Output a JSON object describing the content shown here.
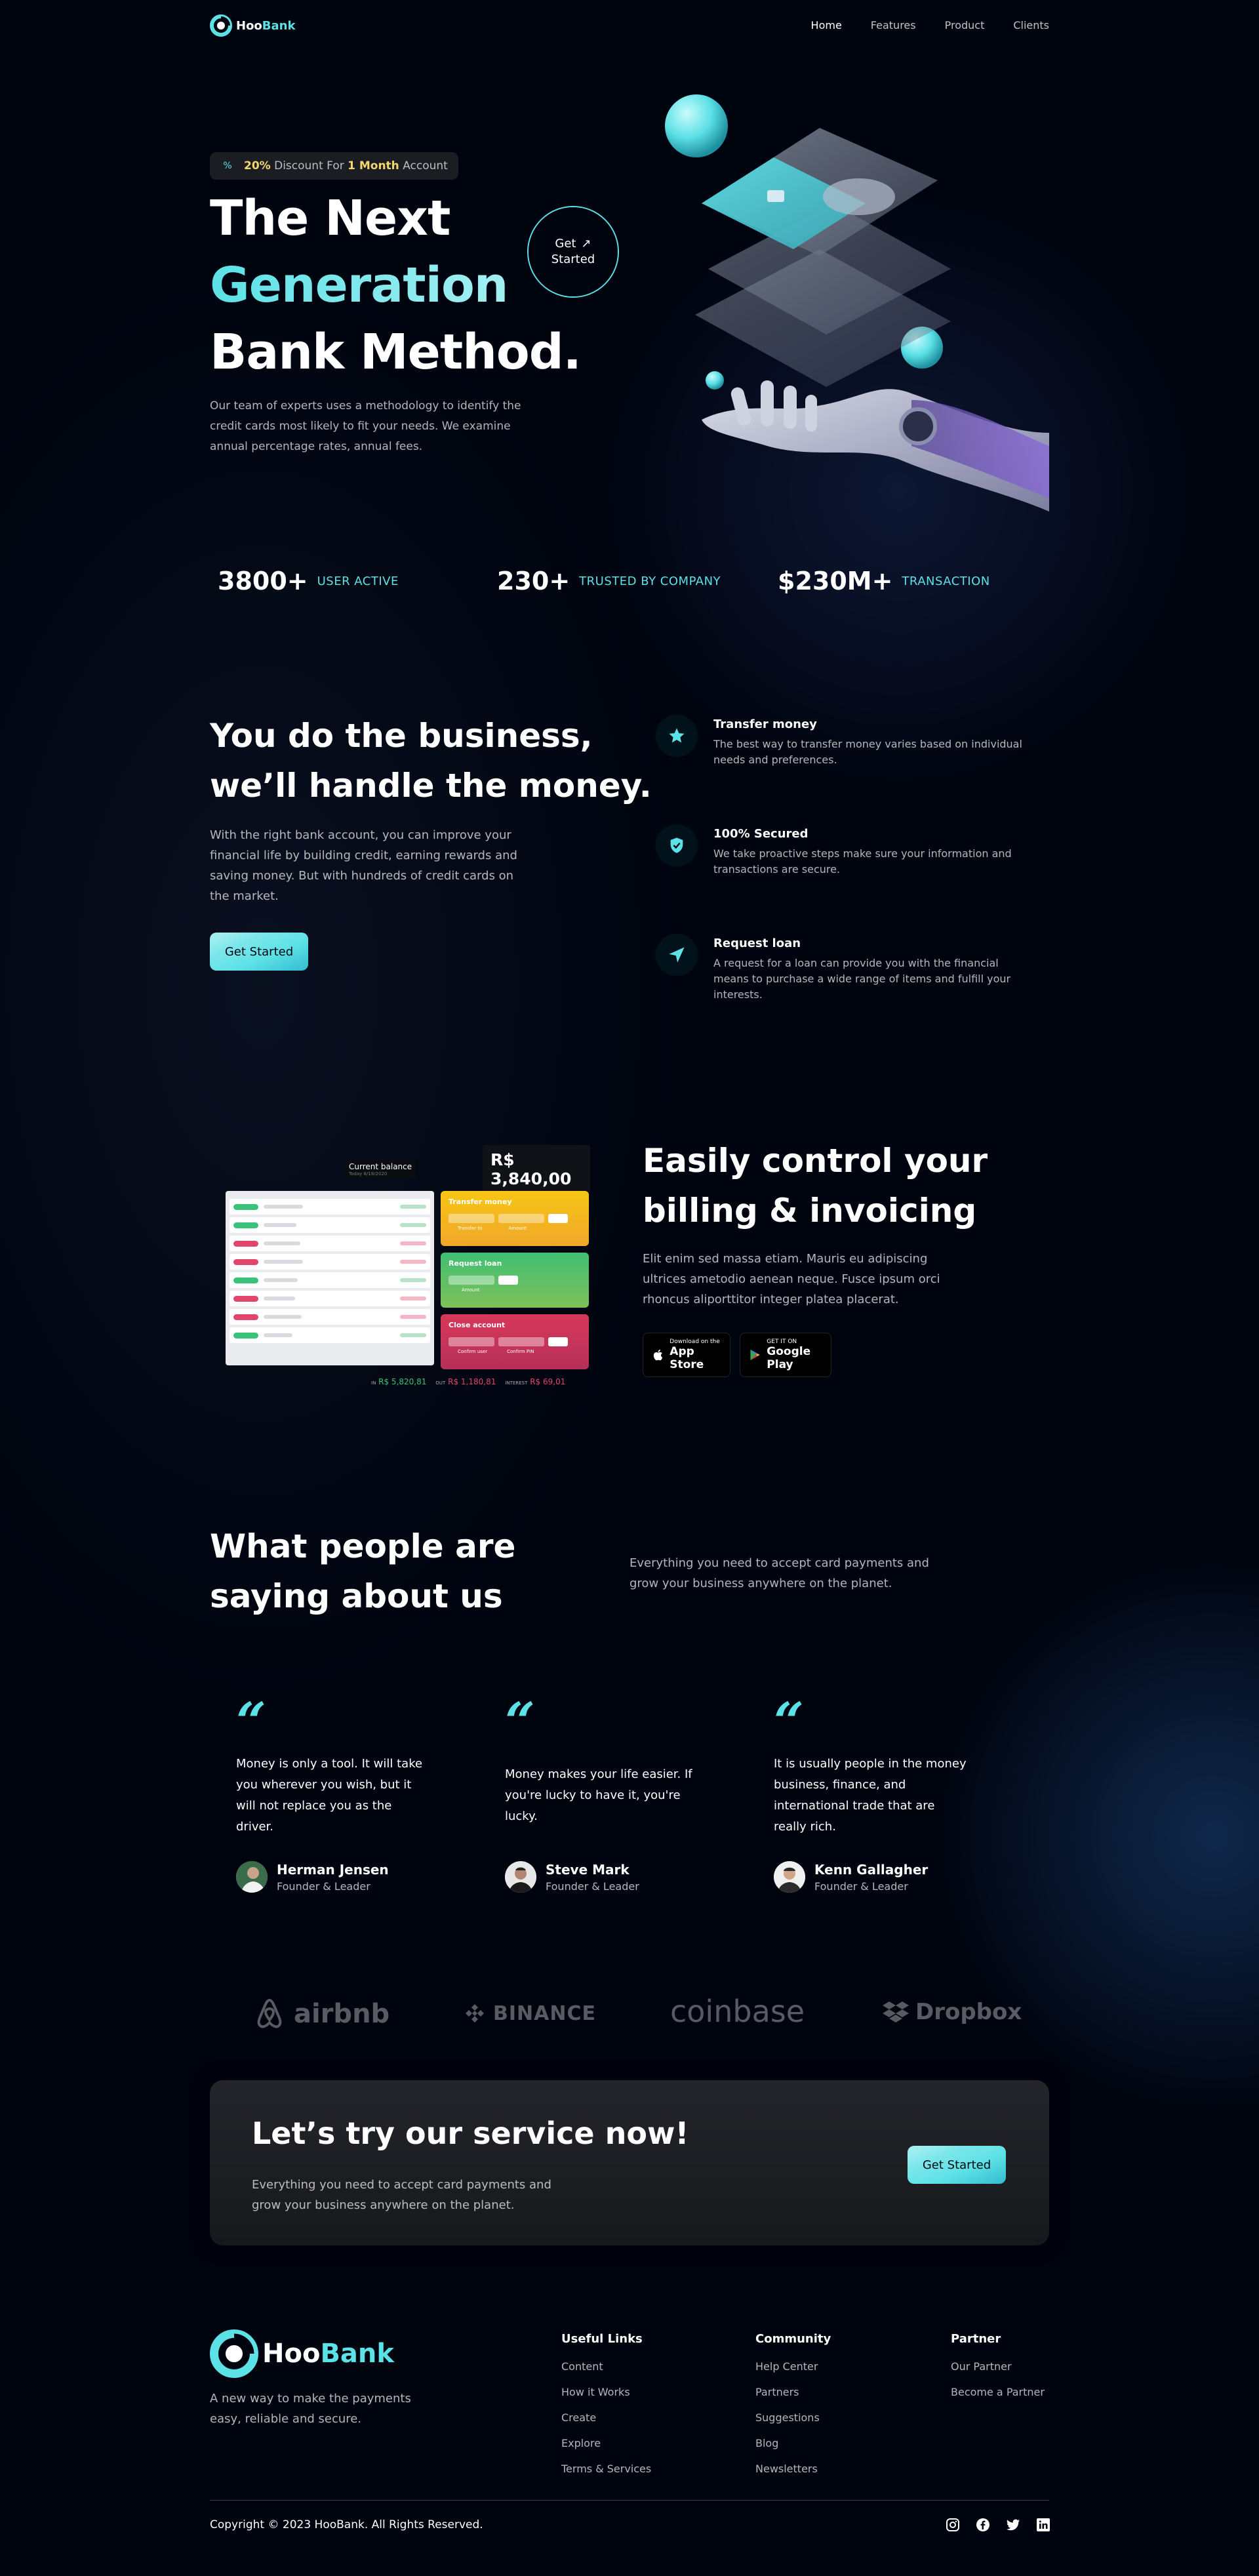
{
  "brand": {
    "name_part1": "Hoo",
    "name_part2": "Bank",
    "accent": "#5ce1e6",
    "background": "#00040f"
  },
  "nav": {
    "items": [
      {
        "label": "Home",
        "active": true
      },
      {
        "label": "Features",
        "active": false
      },
      {
        "label": "Product",
        "active": false
      },
      {
        "label": "Clients",
        "active": false
      }
    ]
  },
  "hero": {
    "discount_icon": "discount-icon",
    "discount_pct": "20%",
    "discount_mid": " Discount For ",
    "discount_period": "1 Month",
    "discount_tail": " Account",
    "title_line1": "The Next",
    "title_line2": "Generation",
    "title_line3": "Bank Method.",
    "cta_line1": "Get",
    "cta_line2": "Started",
    "description": "Our team of experts uses a methodology to identify the credit cards most likely to fit your needs. We examine annual percentage rates, annual fees."
  },
  "stats": [
    {
      "value": "3800+",
      "label": "User Active"
    },
    {
      "value": "230+",
      "label": "Trusted by Company"
    },
    {
      "value": "$230M+",
      "label": "Transaction"
    }
  ],
  "business": {
    "title_line1": "You do the business,",
    "title_line2": "we’ll handle the money.",
    "description": "With the right bank account, you can improve your financial life by building credit, earning rewards and saving money. But with hundreds of credit cards on the market.",
    "button": "Get Started",
    "features": [
      {
        "icon": "star-icon",
        "title": "Transfer money",
        "text": "The best way to transfer money varies based on individual needs and preferences."
      },
      {
        "icon": "shield-icon",
        "title": "100% Secured",
        "text": "We take proactive steps make sure your information and transactions are secure."
      },
      {
        "icon": "send-icon",
        "title": "Request loan",
        "text": "A request for a loan can provide you with the financial means to purchase a wide range of items and fulfill your interests."
      }
    ]
  },
  "billing": {
    "title_line1": "Easily control your",
    "title_line2": "billing & invoicing",
    "description": "Elit enim sed massa etiam. Mauris eu adipiscing ultrices ametodio aenean neque. Fusce ipsum orci rhoncus aliporttitor integer platea placerat.",
    "mock": {
      "balance_label": "Current balance",
      "balance_sub": "Today 8/18/2020",
      "balance_value": "R$ 3,840,00",
      "in_label": "IN",
      "in_value": "R$ 5,820,81",
      "out_label": "OUT",
      "out_value": "R$ 1,180,81",
      "interest_label": "INTEREST",
      "interest_value": "R$ 69,01",
      "card_transfer": "Transfer money",
      "card_transfer_a": "Transfer to",
      "card_transfer_b": "Amount",
      "card_loan": "Request loan",
      "card_loan_a": "Amount",
      "card_close": "Close account",
      "card_close_a": "Confirm user",
      "card_close_b": "Confirm PIN"
    },
    "appstore_small": "Download on the",
    "appstore_big": "App Store",
    "googleplay_small": "GET IT ON",
    "googleplay_big": "Google Play"
  },
  "testimonials": {
    "title_line1": "What people are",
    "title_line2": "saying about us",
    "description": "Everything you need to accept card payments and grow your business anywhere on the planet.",
    "items": [
      {
        "text": "Money is only a tool. It will take you wherever you wish, but it will not replace you as the driver.",
        "name": "Herman Jensen",
        "role": "Founder & Leader"
      },
      {
        "text": "Money makes your life easier. If you're lucky to have it, you're lucky.",
        "name": "Steve Mark",
        "role": "Founder & Leader"
      },
      {
        "text": "It is usually people in the money business, finance, and international trade that are really rich.",
        "name": "Kenn Gallagher",
        "role": "Founder & Leader"
      }
    ]
  },
  "clients": [
    {
      "name": "airbnb",
      "icon": "airbnb-logo-icon"
    },
    {
      "name": "BINANCE",
      "icon": "binance-logo-icon"
    },
    {
      "name": "coinbase",
      "icon": "coinbase-logo-icon"
    },
    {
      "name": "Dropbox",
      "icon": "dropbox-logo-icon"
    }
  ],
  "cta": {
    "title": "Let’s try our service now!",
    "description": "Everything you need to accept card payments and grow your business anywhere on the planet.",
    "button": "Get Started"
  },
  "footer": {
    "tagline": "A new way to make the payments easy, reliable and secure.",
    "columns": [
      {
        "title": "Useful Links",
        "links": [
          "Content",
          "How it Works",
          "Create",
          "Explore",
          "Terms & Services"
        ]
      },
      {
        "title": "Community",
        "links": [
          "Help Center",
          "Partners",
          "Suggestions",
          "Blog",
          "Newsletters"
        ]
      },
      {
        "title": "Partner",
        "links": [
          "Our Partner",
          "Become a Partner"
        ]
      }
    ],
    "copyright": "Copyright © 2023 HooBank. All Rights Reserved.",
    "socials": [
      "instagram-icon",
      "facebook-icon",
      "twitter-icon",
      "linkedin-icon"
    ]
  }
}
